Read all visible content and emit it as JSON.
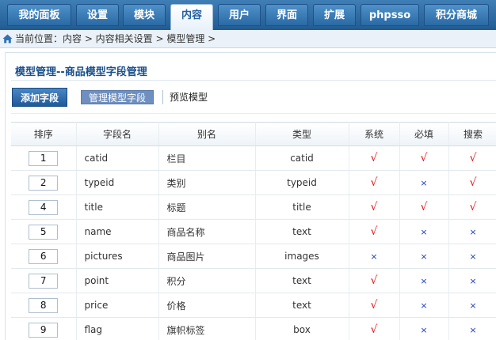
{
  "topnav": {
    "tabs": [
      {
        "label": "我的面板",
        "active": false
      },
      {
        "label": "设置",
        "active": false
      },
      {
        "label": "模块",
        "active": false
      },
      {
        "label": "内容",
        "active": true
      },
      {
        "label": "用户",
        "active": false
      },
      {
        "label": "界面",
        "active": false
      },
      {
        "label": "扩展",
        "active": false
      },
      {
        "label": "phpsso",
        "active": false
      },
      {
        "label": "积分商城",
        "active": false
      }
    ]
  },
  "breadcrumb": {
    "icon": "home-icon",
    "text": "当前位置：内容 > 内容相关设置 > 模型管理 >"
  },
  "page": {
    "title": "模型管理--商品模型字段管理"
  },
  "toolbar": {
    "add_label": "添加字段",
    "manage_label": "管理模型字段",
    "preview_label": "预览模型"
  },
  "table": {
    "headers": [
      "排序",
      "字段名",
      "别名",
      "类型",
      "系统",
      "必填",
      "搜索"
    ],
    "yes_glyph": "√",
    "no_glyph": "×",
    "rows": [
      {
        "order": "1",
        "field": "catid",
        "alias": "栏目",
        "type": "catid",
        "system": "yes",
        "required": "yes",
        "search": "yes"
      },
      {
        "order": "2",
        "field": "typeid",
        "alias": "类别",
        "type": "typeid",
        "system": "yes",
        "required": "no",
        "search": "yes"
      },
      {
        "order": "4",
        "field": "title",
        "alias": "标题",
        "type": "title",
        "system": "yes",
        "required": "yes",
        "search": "yes"
      },
      {
        "order": "5",
        "field": "name",
        "alias": "商品名称",
        "type": "text",
        "system": "yes",
        "required": "no",
        "search": "no"
      },
      {
        "order": "6",
        "field": "pictures",
        "alias": "商品图片",
        "type": "images",
        "system": "no",
        "required": "no",
        "search": "no"
      },
      {
        "order": "7",
        "field": "point",
        "alias": "积分",
        "type": "text",
        "system": "yes",
        "required": "no",
        "search": "no"
      },
      {
        "order": "8",
        "field": "price",
        "alias": "价格",
        "type": "text",
        "system": "yes",
        "required": "no",
        "search": "no"
      },
      {
        "order": "9",
        "field": "flag",
        "alias": "旗帜标签",
        "type": "box",
        "system": "yes",
        "required": "no",
        "search": "no"
      }
    ]
  },
  "colors": {
    "nav_blue": "#215b92",
    "title_blue": "#1a4f89",
    "yes_red": "#e6161b",
    "no_blue": "#1f3fb8"
  }
}
